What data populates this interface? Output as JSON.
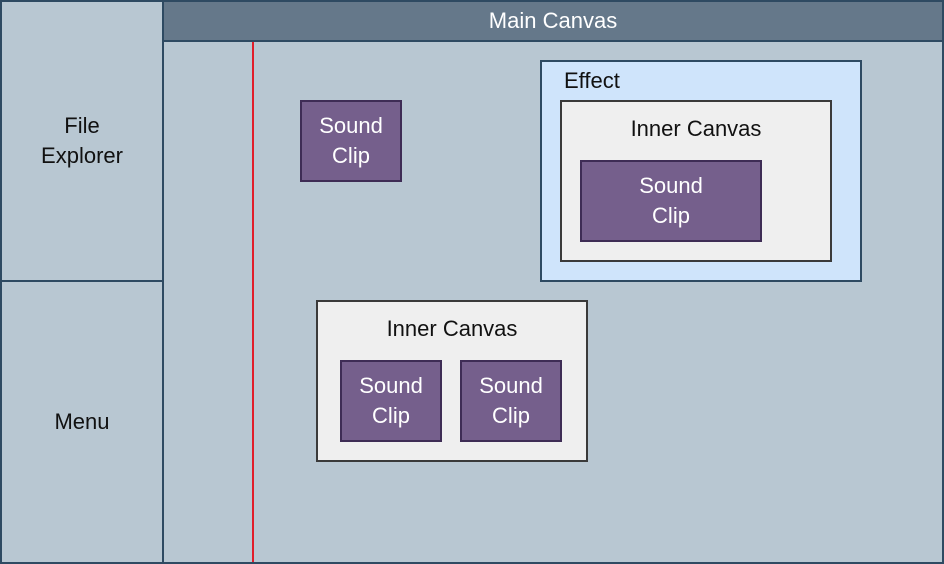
{
  "main_canvas": {
    "title": "Main Canvas"
  },
  "file_explorer": {
    "label_line1": "File",
    "label_line2": "Explorer"
  },
  "menu": {
    "label": "Menu"
  },
  "effect": {
    "label": "Effect",
    "inner_canvas": {
      "title": "Inner Canvas",
      "clip": {
        "line1": "Sound",
        "line2": "Clip"
      }
    }
  },
  "standalone_clip": {
    "line1": "Sound",
    "line2": "Clip"
  },
  "inner_canvas_2": {
    "title": "Inner Canvas",
    "clips": [
      {
        "line1": "Sound",
        "line2": "Clip"
      },
      {
        "line1": "Sound",
        "line2": "Clip"
      }
    ]
  },
  "colors": {
    "background": "#b8c7d2",
    "header": "#65788a",
    "sound_clip": "#755f8c",
    "inner_canvas": "#efefef",
    "effect": "#cfe4fb",
    "playhead": "#e11d2a"
  }
}
